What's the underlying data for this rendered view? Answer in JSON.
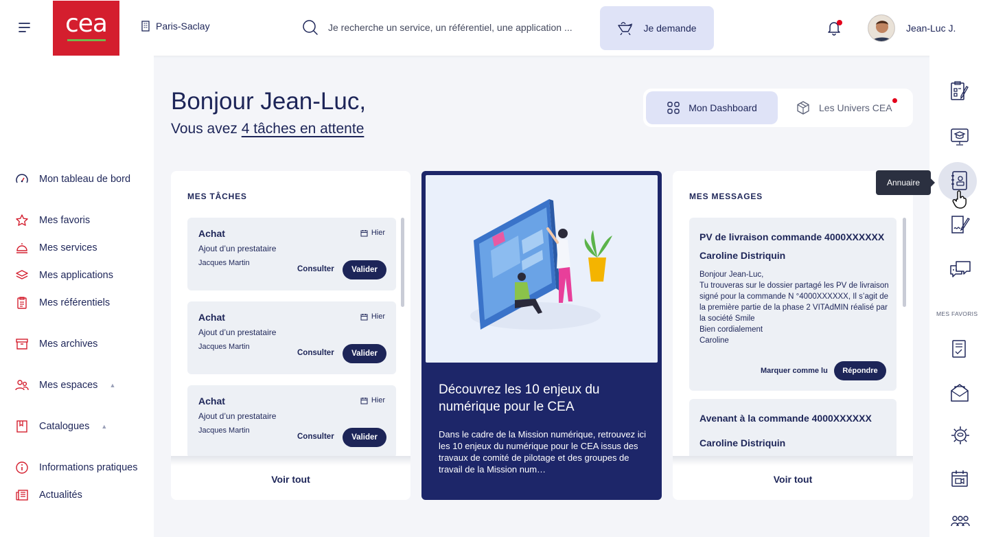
{
  "header": {
    "logo_text": "cea",
    "site": "Paris-Saclay",
    "search_placeholder": "Je recherche un service, un référentiel, une application ...",
    "demand_label": "Je demande",
    "user_name": "Jean-Luc J."
  },
  "nav": {
    "items": [
      {
        "label": "Mon tableau de bord",
        "icon": "dashboard-gauge-icon"
      },
      {
        "label": "Mes favoris",
        "icon": "star-icon"
      },
      {
        "label": "Mes services",
        "icon": "cloche-service-icon"
      },
      {
        "label": "Mes applications",
        "icon": "layers-icon"
      },
      {
        "label": "Mes référentiels",
        "icon": "clipboard-icon"
      },
      {
        "label": "Mes archives",
        "icon": "archive-box-icon"
      },
      {
        "label": "Mes espaces",
        "icon": "users-icon"
      },
      {
        "label": "Catalogues",
        "icon": "book-icon"
      },
      {
        "label": "Informations pratiques",
        "icon": "info-icon"
      },
      {
        "label": "Actualités",
        "icon": "newspaper-icon"
      }
    ]
  },
  "greeting": {
    "title": "Bonjour Jean-Luc,",
    "prefix": "Vous avez ",
    "link": "4 tâches en attente"
  },
  "toggle": {
    "dashboard": "Mon Dashboard",
    "univers": "Les Univers CEA"
  },
  "tasks": {
    "title": "MES TÂCHES",
    "items": [
      {
        "title": "Achat",
        "date": "Hier",
        "desc": "Ajout d’un prestataire",
        "person": "Jacques Martin",
        "consult": "Consulter",
        "validate": "Valider"
      },
      {
        "title": "Achat",
        "date": "Hier",
        "desc": "Ajout d’un prestataire",
        "person": "Jacques Martin",
        "consult": "Consulter",
        "validate": "Valider"
      },
      {
        "title": "Achat",
        "date": "Hier",
        "desc": "Ajout d’un prestataire",
        "person": "Jacques Martin",
        "consult": "Consulter",
        "validate": "Valider"
      }
    ],
    "see_all": "Voir tout"
  },
  "feature": {
    "title": "Découvrez les 10 enjeux du numérique pour le CEA",
    "description": "Dans le cadre de la Mission numérique, retrouvez ici les 10 enjeux du numérique pour le CEA issus des travaux de comité de pilotage et des groupes de travail de la Mission num…"
  },
  "messages": {
    "title": "MES MESSAGES",
    "items": [
      {
        "subject": "PV de livraison commande 4000XXXXXX",
        "sender": "Caroline Distriquin",
        "body": "Bonjour Jean-Luc,\nTu trouveras sur le dossier partagé les PV de livraison signé pour la commande N °4000XXXXXX, Il s’agit de la première partie de la phase 2 VITAdMIN réalisé par la société Smile\nBien cordialement\nCaroline",
        "mark_read": "Marquer comme lu",
        "reply": "Répondre"
      },
      {
        "subject": "Avenant à la commande 4000XXXXXX",
        "sender": "Caroline Distriquin"
      }
    ],
    "see_all": "Voir tout"
  },
  "rightbar": {
    "favorites_label": "MES FAVORIS",
    "tooltip": "Annuaire"
  },
  "colors": {
    "brand_red": "#d41e2e",
    "navy": "#1d2669",
    "accent_light": "#dfe3f7",
    "notification": "#e3001b"
  }
}
